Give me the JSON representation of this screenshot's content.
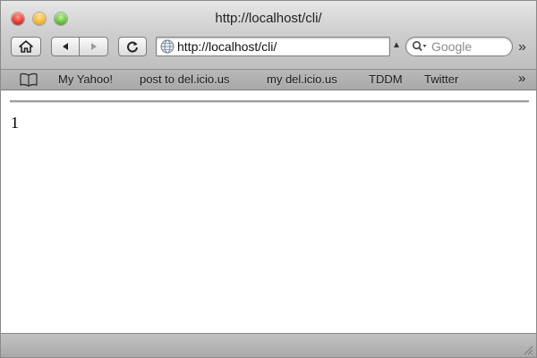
{
  "window": {
    "title": "http://localhost/cli/"
  },
  "toolbar": {
    "address_value": "http://localhost/cli/",
    "search_placeholder": "Google",
    "overflow_glyph": "»",
    "dropdown_glyph": "▲"
  },
  "bookmarks": {
    "items": [
      {
        "label": "My Yahoo!"
      },
      {
        "label": "post to del.icio.us"
      },
      {
        "label": "my del.icio.us"
      },
      {
        "label": "TDDM"
      },
      {
        "label": "Twitter"
      }
    ],
    "overflow_glyph": "»"
  },
  "page": {
    "body_text": "1"
  },
  "icons": {
    "home": "home-icon",
    "back": "back-arrow-icon",
    "forward": "forward-arrow-icon",
    "reload": "reload-icon",
    "site": "globe-icon",
    "search": "search-icon",
    "bookmarks": "book-icon"
  },
  "colors": {
    "close": "#e0302a",
    "minimize": "#f3b42a",
    "zoom": "#5fbf34"
  }
}
